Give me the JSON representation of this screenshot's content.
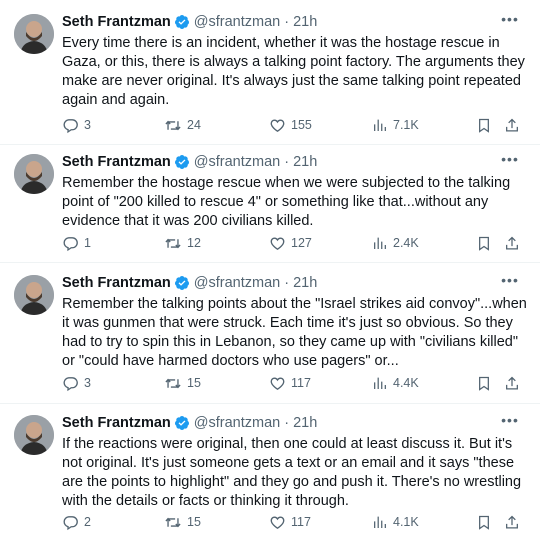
{
  "tweets": [
    {
      "author": "Seth Frantzman",
      "handle": "@sfrantzman",
      "time": "21h",
      "text": "Every time there is an incident, whether it was the hostage rescue in Gaza, or this, there is always a talking point factory. The arguments they make are never original. It's always just the same talking point repeated again and again.",
      "replies": "3",
      "retweets": "24",
      "likes": "155",
      "views": "7.1K"
    },
    {
      "author": "Seth Frantzman",
      "handle": "@sfrantzman",
      "time": "21h",
      "text": "Remember the hostage rescue when we were subjected to the talking point of \"200 killed to rescue 4\" or something like that...without any evidence that it was 200 civilians killed.",
      "replies": "1",
      "retweets": "12",
      "likes": "127",
      "views": "2.4K"
    },
    {
      "author": "Seth Frantzman",
      "handle": "@sfrantzman",
      "time": "21h",
      "text": "Remember the talking points about the \"Israel strikes aid convoy\"...when it was gunmen that were struck. Each time it's just so obvious. So they had to try to spin this in Lebanon, so they came up with \"civilians killed\" or \"could have harmed doctors who use pagers\" or...",
      "replies": "3",
      "retweets": "15",
      "likes": "117",
      "views": "4.4K"
    },
    {
      "author": "Seth Frantzman",
      "handle": "@sfrantzman",
      "time": "21h",
      "text": "If the reactions were original, then one could at least discuss it. But it's not original. It's just someone gets a text or an email and it says \"these are the points to highlight\" and they go and push it. There's no wrestling with the details or facts or thinking it through.",
      "replies": "2",
      "retweets": "15",
      "likes": "117",
      "views": "4.1K"
    }
  ],
  "icons": {
    "verified": "verified-badge-icon",
    "more": "more-icon",
    "reply": "reply-icon",
    "retweet": "retweet-icon",
    "like": "like-icon",
    "views": "views-icon",
    "bookmark": "bookmark-icon",
    "share": "share-icon"
  },
  "colors": {
    "verified": "#1d9bf0",
    "secondary_text": "#536471",
    "primary_text": "#0f1419"
  }
}
